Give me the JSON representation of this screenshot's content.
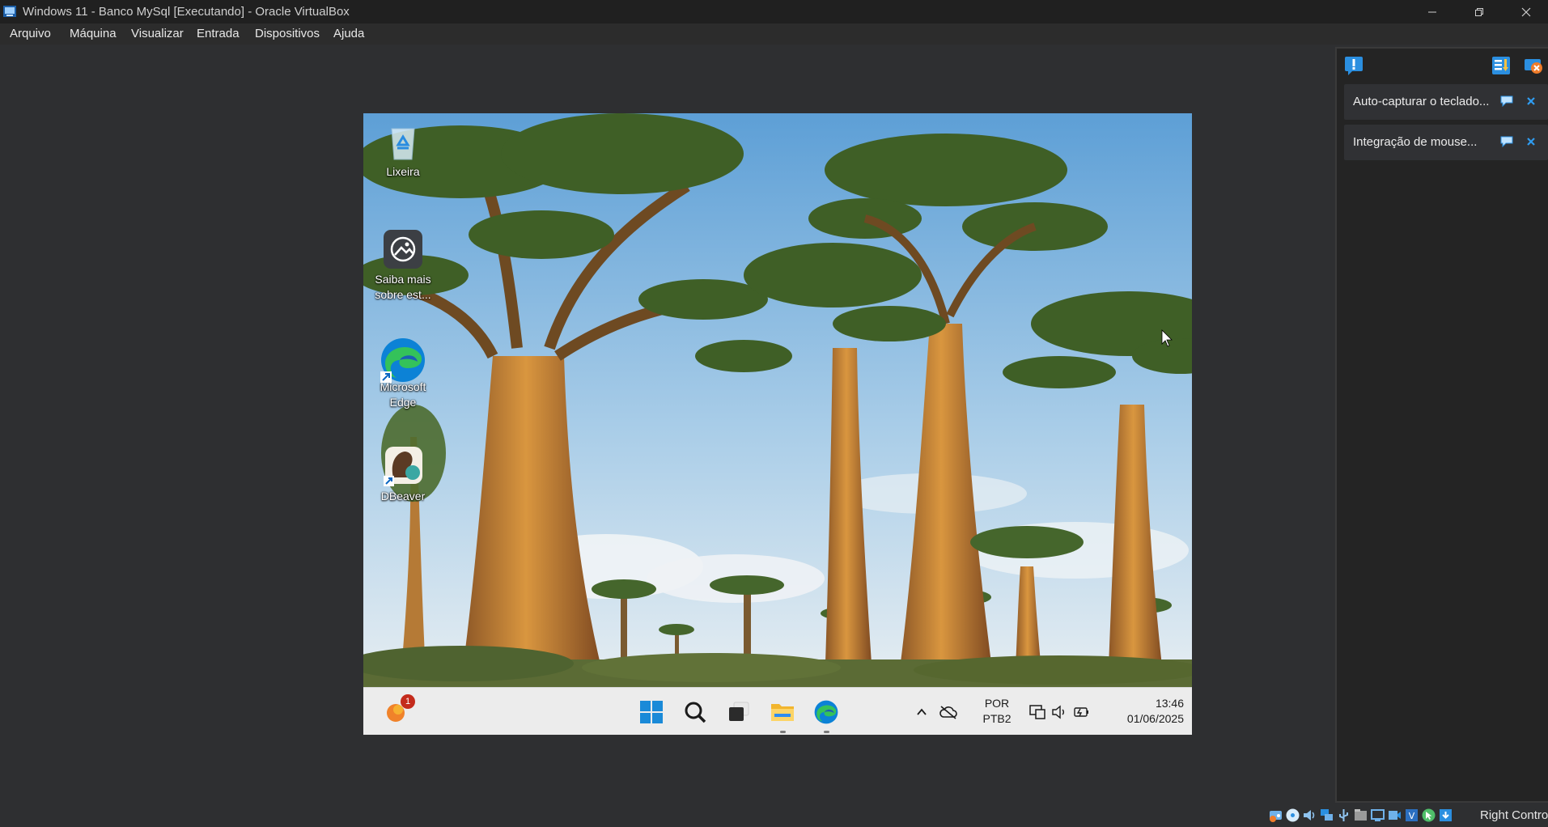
{
  "window": {
    "title": "Windows 11 - Banco MySql [Executando] - Oracle VirtualBox",
    "icons": [
      "virtualbox-app-icon",
      "minimize-icon",
      "restore-icon",
      "close-icon"
    ]
  },
  "menu": [
    "Arquivo",
    "Máquina",
    "Visualizar",
    "Entrada",
    "Dispositivos",
    "Ajuda"
  ],
  "vm": {
    "desktop_icons": [
      {
        "label": "Lixeira",
        "icon": "recycle-bin-icon"
      },
      {
        "label": "Saiba mais sobre est...",
        "icon": "learn-about-picture-icon"
      },
      {
        "label": "Microsoft Edge",
        "icon": "edge-icon"
      },
      {
        "label": "DBeaver",
        "icon": "dbeaver-icon"
      }
    ],
    "taskbar": {
      "widgets_badge": "1",
      "apps": [
        "windows-start-icon",
        "search-icon",
        "task-view-icon",
        "file-explorer-icon",
        "edge-icon"
      ],
      "tray": {
        "language_top": "POR",
        "language_bottom": "PTB2",
        "time": "13:46",
        "date": "01/06/2025"
      }
    }
  },
  "notifications": {
    "items": [
      {
        "text": "Auto-capturar o teclado..."
      },
      {
        "text": "Integração de mouse..."
      }
    ]
  },
  "statusbar": {
    "host_key": "Right Control",
    "icons": [
      "hard-disk-icon",
      "optical-drive-icon",
      "audio-icon",
      "network-icon",
      "usb-icon",
      "shared-folders-icon",
      "display-icon",
      "recording-icon",
      "virtualization-icon",
      "mouse-integration-icon",
      "keyboard-capture-icon"
    ]
  },
  "colors": {
    "titlebar": "#202020",
    "background": "#2e2f31",
    "panel": "#242424",
    "taskbar": "#ececec",
    "accent": "#2f8df0"
  }
}
